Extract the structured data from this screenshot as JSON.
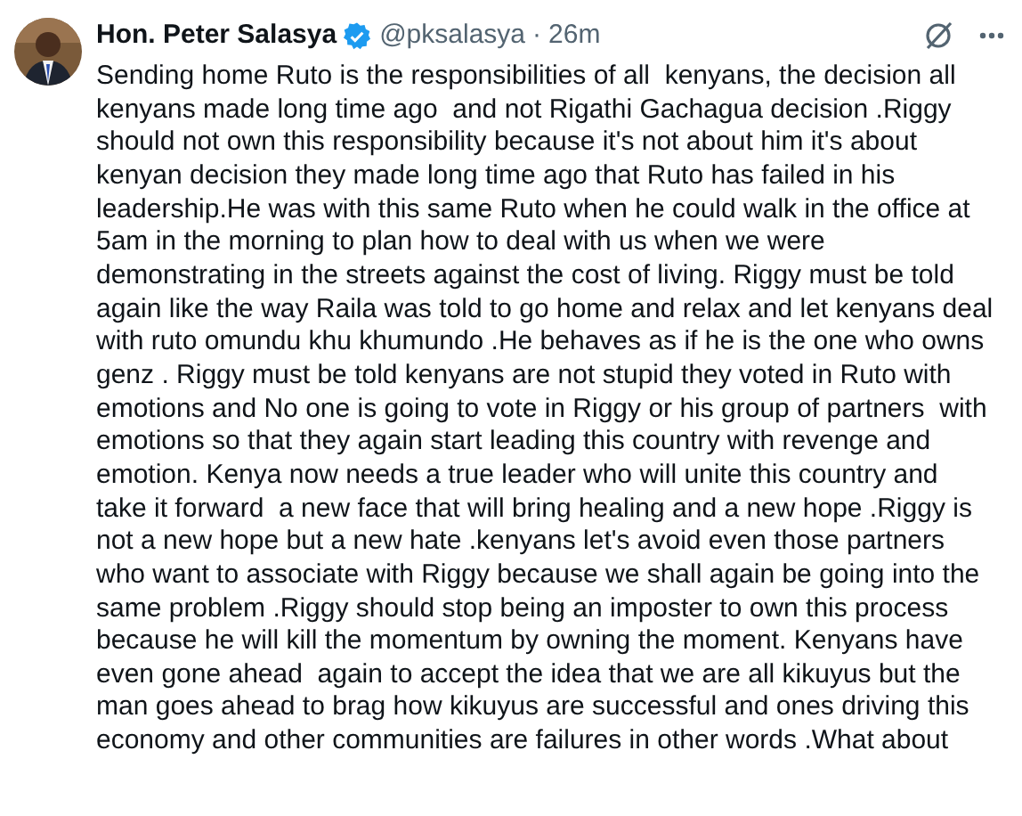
{
  "post": {
    "author": "Hon. Peter Salasya",
    "verified": true,
    "handle": "@pksalasya",
    "separator": "·",
    "time": "26m",
    "lines": [
      "Sending home Ruto is the responsibilities of all  kenyans, the decision all",
      "kenyans made long time ago  and not Rigathi Gachagua decision .Riggy",
      "should not own this responsibility because it's not about him it's about",
      "kenyan decision they made long time ago that Ruto has failed in his",
      "leadership.He was with this same Ruto when he could walk in the office at",
      "5am in the morning to plan how to deal with us when we were",
      "demonstrating in the streets against the cost of living. Riggy must be told",
      "again like the way Raila was told to go home and relax and let kenyans deal",
      "with ruto omundu khu khumundo .He behaves as if he is the one who owns",
      "genz . Riggy must be told kenyans are not stupid they voted in Ruto with",
      "emotions and No one is going to vote in Riggy or his group of partners  with",
      "emotions so that they again start leading this country with revenge and",
      "emotion. Kenya now needs a true leader who will unite this country and",
      "take it forward  a new face that will bring healing and a new hope .Riggy is",
      "not a new hope but a new hate .kenyans let's avoid even those partners",
      "who want to associate with Riggy because we shall again be going into the",
      "same problem .Riggy should stop being an imposter to own this process",
      "because he will kill the momentum by owning the moment. Kenyans have",
      "even gone ahead  again to accept the idea that we are all kikuyus but the",
      "man goes ahead to brag how kikuyus are successful and ones driving this",
      "economy and other communities are failures in other words .What about"
    ]
  }
}
